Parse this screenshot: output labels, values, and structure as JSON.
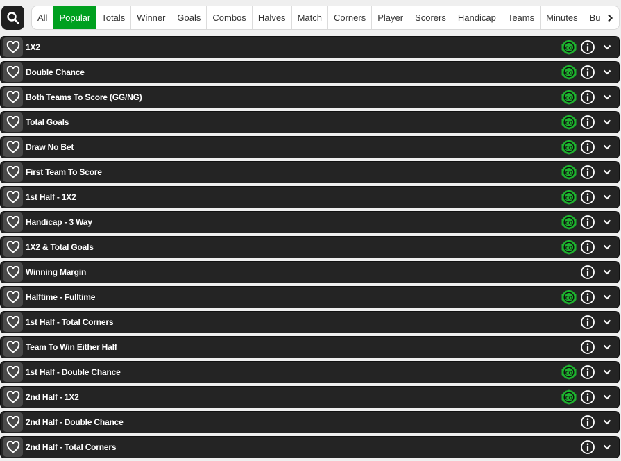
{
  "header": {
    "search_icon": "search-icon",
    "tabs": [
      {
        "label": "All",
        "active": false
      },
      {
        "label": "Popular",
        "active": true
      },
      {
        "label": "Totals",
        "active": false
      },
      {
        "label": "Winner",
        "active": false
      },
      {
        "label": "Goals",
        "active": false
      },
      {
        "label": "Combos",
        "active": false
      },
      {
        "label": "Halves",
        "active": false
      },
      {
        "label": "Match",
        "active": false
      },
      {
        "label": "Corners",
        "active": false
      },
      {
        "label": "Player",
        "active": false
      },
      {
        "label": "Scorers",
        "active": false
      },
      {
        "label": "Handicap",
        "active": false
      },
      {
        "label": "Teams",
        "active": false
      },
      {
        "label": "Minutes",
        "active": false
      },
      {
        "label": "Build A Bet",
        "active": false
      }
    ],
    "next_icon": "chevron-right-icon"
  },
  "colors": {
    "accent": "#00a01f",
    "row_bg": "#242424",
    "fav_bg": "#4a4a4a",
    "cashout_green": "#1db32e"
  },
  "markets": [
    {
      "label": "1X2",
      "cashout": true
    },
    {
      "label": "Double Chance",
      "cashout": true
    },
    {
      "label": "Both Teams To Score (GG/NG)",
      "cashout": true
    },
    {
      "label": "Total Goals",
      "cashout": true
    },
    {
      "label": "Draw No Bet",
      "cashout": true
    },
    {
      "label": "First Team To Score",
      "cashout": true
    },
    {
      "label": "1st Half - 1X2",
      "cashout": true
    },
    {
      "label": "Handicap - 3 Way",
      "cashout": true
    },
    {
      "label": "1X2 & Total Goals",
      "cashout": true
    },
    {
      "label": "Winning Margin",
      "cashout": false
    },
    {
      "label": "Halftime - Fulltime",
      "cashout": true
    },
    {
      "label": "1st Half - Total Corners",
      "cashout": false
    },
    {
      "label": "Team To Win Either Half",
      "cashout": false
    },
    {
      "label": "1st Half - Double Chance",
      "cashout": true
    },
    {
      "label": "2nd Half - 1X2",
      "cashout": true
    },
    {
      "label": "2nd Half - Double Chance",
      "cashout": false
    },
    {
      "label": "2nd Half - Total Corners",
      "cashout": false
    }
  ]
}
